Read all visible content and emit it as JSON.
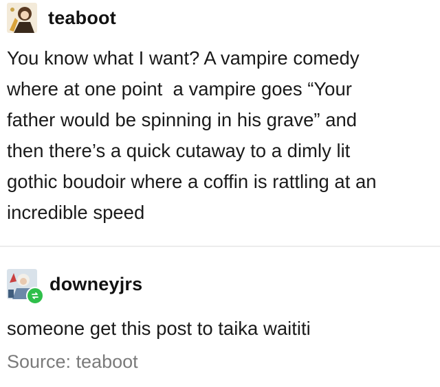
{
  "original_post": {
    "username": "teaboot",
    "avatar_icon": "user-avatar-icon",
    "lines": [
      "You know what I want? A vampire comedy",
      "where at one point  a vampire goes “Your",
      "father would be spinning in his grave” and",
      "then there’s a quick cutaway to a dimly lit",
      "gothic boudoir where a coffin is rattling at an",
      "incredible speed"
    ]
  },
  "reblog": {
    "username": "downeyjrs",
    "avatar_icon": "user-avatar-icon",
    "badge_icon": "reblog-icon",
    "text": "someone get this post to taika waititi"
  },
  "source": {
    "text": "Source: teaboot"
  },
  "colors": {
    "reblog_badge": "#2fbf4a",
    "source_text": "#7a7a7a"
  }
}
